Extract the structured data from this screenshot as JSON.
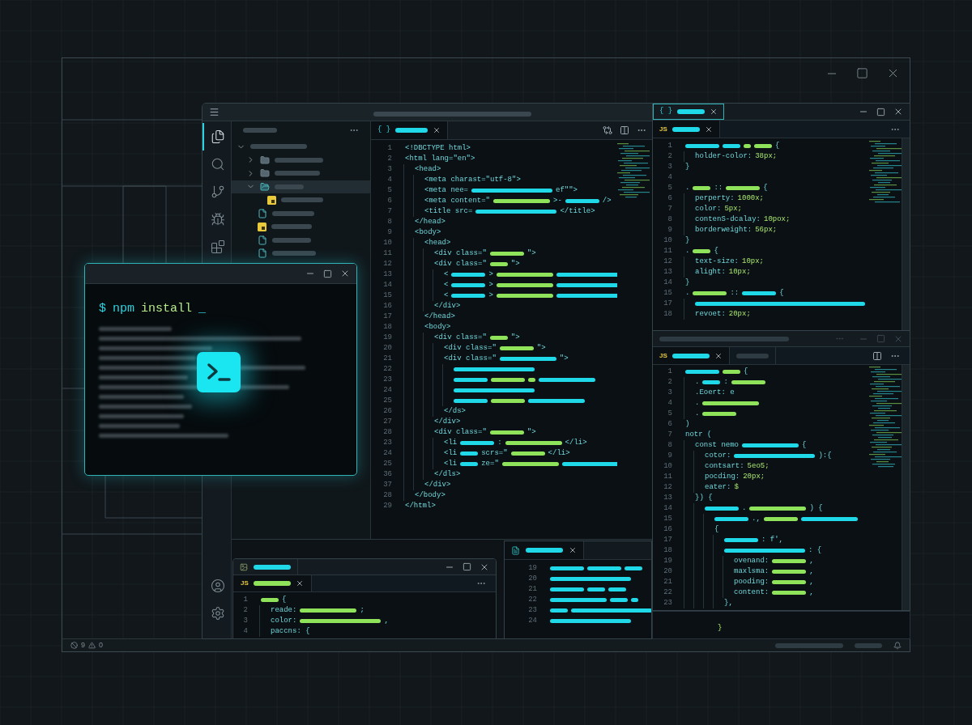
{
  "desktop_window": {
    "status_bar": {
      "errors": "9",
      "warnings": "0"
    }
  },
  "ide": {
    "activity_bar": [
      {
        "kind": "files",
        "selected": true
      },
      {
        "kind": "search",
        "selected": false
      },
      {
        "kind": "source-control",
        "selected": false
      },
      {
        "kind": "debug",
        "selected": false
      },
      {
        "kind": "extensions",
        "selected": false
      }
    ],
    "activity_bar_bottom": [
      {
        "kind": "account",
        "selected": false
      },
      {
        "kind": "settings",
        "selected": false
      }
    ],
    "explorer": {
      "items": [
        {
          "kind": "folder",
          "expanded": true,
          "selected": false,
          "children": [
            {
              "kind": "folder",
              "expanded": false,
              "selected": false
            },
            {
              "kind": "folder",
              "expanded": false,
              "selected": false
            },
            {
              "kind": "folder",
              "expanded": true,
              "selected": true,
              "children": [
                {
                  "kind": "js-file",
                  "selected": false
                }
              ]
            },
            {
              "kind": "file",
              "selected": false
            },
            {
              "kind": "js-file",
              "selected": false
            },
            {
              "kind": "file",
              "selected": false
            },
            {
              "kind": "file",
              "selected": false
            }
          ]
        }
      ]
    },
    "editor": {
      "tab": {
        "icon_text": "{ }"
      },
      "lines": [
        {
          "n": "1",
          "tokens": [
            {
              "kind": "text",
              "text": "<!DBCTYPE html>"
            }
          ]
        },
        {
          "n": "2",
          "tokens": [
            {
              "kind": "text",
              "text": "<html lang=\"en\">"
            }
          ],
          "children": [
            {
              "n": "3",
              "tokens": [
                {
                  "kind": "text",
                  "text": "<head>"
                }
              ],
              "children": [
                {
                  "n": "4",
                  "tokens": [
                    {
                      "kind": "text",
                      "text": "<meta charast=\"utf-8\">"
                    }
                  ]
                },
                {
                  "n": "5",
                  "tokens": [
                    {
                      "kind": "text",
                      "text": "<meta nee="
                    },
                    {
                      "kind": "wide-bar",
                      "color": "#1fd8e8"
                    },
                    {
                      "kind": "text",
                      "text": "ef\"\">"
                    }
                  ]
                },
                {
                  "n": "6",
                  "tokens": [
                    {
                      "kind": "text",
                      "text": "<meta content=\""
                    },
                    {
                      "kind": "long-bar",
                      "color": "#8fe35a"
                    },
                    {
                      "kind": "text",
                      "text": ">-"
                    },
                    {
                      "kind": "bar",
                      "color": "#1fd8e8"
                    },
                    {
                      "kind": "text",
                      "text": "/>"
                    }
                  ]
                },
                {
                  "n": "7",
                  "tokens": [
                    {
                      "kind": "text",
                      "text": "<title src="
                    },
                    {
                      "kind": "wide-bar",
                      "color": "#1fd8e8"
                    },
                    {
                      "kind": "text",
                      "text": "</title>"
                    }
                  ]
                }
              ]
            },
            {
              "n": "8",
              "tokens": [
                {
                  "kind": "text",
                  "text": "</head>"
                }
              ]
            },
            {
              "n": "9",
              "tokens": [
                {
                  "kind": "text",
                  "text": "<body>"
                }
              ],
              "children": [
                {
                  "n": "10",
                  "tokens": [
                    {
                      "kind": "text",
                      "text": "<head>"
                    }
                  ],
                  "children": [
                    {
                      "n": "11",
                      "tokens": [
                        {
                          "kind": "text",
                          "text": "<div class=\""
                        },
                        {
                          "kind": "bar",
                          "color": "#8fe35a"
                        },
                        {
                          "kind": "text",
                          "text": "\">"
                        }
                      ]
                    },
                    {
                      "n": "12",
                      "tokens": [
                        {
                          "kind": "text",
                          "text": "<div class=\""
                        },
                        {
                          "kind": "short-bar",
                          "color": "#8fe35a"
                        },
                        {
                          "kind": "text",
                          "text": "\">"
                        }
                      ],
                      "children": [
                        {
                          "n": "13",
                          "tokens": [
                            {
                              "kind": "text",
                              "text": "<"
                            },
                            {
                              "kind": "bar",
                              "color": "#1fd8e8"
                            },
                            {
                              "kind": "text",
                              "text": ">"
                            },
                            {
                              "kind": "long-bar",
                              "color": "#8fe35a"
                            },
                            {
                              "kind": "wide-bar",
                              "color": "#1fd8e8"
                            }
                          ]
                        },
                        {
                          "n": "14",
                          "tokens": [
                            {
                              "kind": "text",
                              "text": "<"
                            },
                            {
                              "kind": "bar",
                              "color": "#1fd8e8"
                            },
                            {
                              "kind": "text",
                              "text": ">"
                            },
                            {
                              "kind": "long-bar",
                              "color": "#8fe35a"
                            },
                            {
                              "kind": "wide-bar",
                              "color": "#1fd8e8"
                            }
                          ]
                        },
                        {
                          "n": "15",
                          "tokens": [
                            {
                              "kind": "text",
                              "text": "<"
                            },
                            {
                              "kind": "bar",
                              "color": "#1fd8e8"
                            },
                            {
                              "kind": "text",
                              "text": ">"
                            },
                            {
                              "kind": "long-bar",
                              "color": "#8fe35a"
                            },
                            {
                              "kind": "wide-bar",
                              "color": "#1fd8e8"
                            }
                          ]
                        }
                      ]
                    },
                    {
                      "n": "16",
                      "tokens": [
                        {
                          "kind": "text",
                          "text": "</div>"
                        }
                      ]
                    }
                  ]
                },
                {
                  "n": "17",
                  "tokens": [
                    {
                      "kind": "text",
                      "text": "</head>"
                    }
                  ]
                },
                {
                  "n": "18",
                  "tokens": [
                    {
                      "kind": "text",
                      "text": "<body>"
                    }
                  ],
                  "children": [
                    {
                      "n": "19",
                      "tokens": [
                        {
                          "kind": "text",
                          "text": "<div class=\""
                        },
                        {
                          "kind": "short-bar",
                          "color": "#8fe35a"
                        },
                        {
                          "kind": "text",
                          "text": "\">"
                        }
                      ],
                      "children": [
                        {
                          "n": "20",
                          "tokens": [
                            {
                              "kind": "text",
                              "text": "<div class=\""
                            },
                            {
                              "kind": "bar",
                              "color": "#8fe35a"
                            },
                            {
                              "kind": "text",
                              "text": "\">"
                            }
                          ]
                        },
                        {
                          "n": "21",
                          "tokens": [
                            {
                              "kind": "text",
                              "text": "<div class=\""
                            },
                            {
                              "kind": "long-bar",
                              "color": "#1fd8e8"
                            },
                            {
                              "kind": "text",
                              "text": "\">"
                            }
                          ],
                          "children": [
                            {
                              "n": "22",
                              "tokens": [
                                {
                                  "kind": "wide-bar",
                                  "color": "#1fd8e8"
                                }
                              ]
                            },
                            {
                              "n": "23",
                              "tokens": [
                                {
                                  "kind": "bar",
                                  "color": "#1fd8e8"
                                },
                                {
                                  "kind": "bar",
                                  "color": "#8fe35a"
                                },
                                {
                                  "kind": "tiny-bar",
                                  "color": "#8fe35a"
                                },
                                {
                                  "kind": "long-bar",
                                  "color": "#1fd8e8"
                                }
                              ]
                            },
                            {
                              "n": "24",
                              "tokens": [
                                {
                                  "kind": "wide-bar",
                                  "color": "#1fd8e8"
                                }
                              ]
                            },
                            {
                              "n": "25",
                              "tokens": [
                                {
                                  "kind": "bar",
                                  "color": "#1fd8e8"
                                },
                                {
                                  "kind": "bar",
                                  "color": "#8fe35a"
                                },
                                {
                                  "kind": "long-bar",
                                  "color": "#1fd8e8"
                                }
                              ]
                            }
                          ]
                        },
                        {
                          "n": "26",
                          "tokens": [
                            {
                              "kind": "text",
                              "text": "</ds>"
                            }
                          ]
                        }
                      ]
                    },
                    {
                      "n": "27",
                      "tokens": [
                        {
                          "kind": "text",
                          "text": "</div>"
                        }
                      ]
                    },
                    {
                      "n": "28",
                      "tokens": [
                        {
                          "kind": "text",
                          "text": "<div class=\""
                        },
                        {
                          "kind": "bar",
                          "color": "#8fe35a"
                        },
                        {
                          "kind": "text",
                          "text": "\">"
                        }
                      ],
                      "children": [
                        {
                          "n": "23",
                          "tokens": [
                            {
                              "kind": "text",
                              "text": "<li"
                            },
                            {
                              "kind": "bar",
                              "color": "#1fd8e8"
                            },
                            {
                              "kind": "text",
                              "text": ":"
                            },
                            {
                              "kind": "long-bar",
                              "color": "#8fe35a"
                            },
                            {
                              "kind": "text",
                              "text": "</li>"
                            }
                          ]
                        },
                        {
                          "n": "24",
                          "tokens": [
                            {
                              "kind": "text",
                              "text": "<li"
                            },
                            {
                              "kind": "short-bar",
                              "color": "#1fd8e8"
                            },
                            {
                              "kind": "text",
                              "text": "scrs=\""
                            },
                            {
                              "kind": "bar",
                              "color": "#8fe35a"
                            },
                            {
                              "kind": "text",
                              "text": "</li>"
                            }
                          ]
                        },
                        {
                          "n": "25",
                          "tokens": [
                            {
                              "kind": "text",
                              "text": "<li"
                            },
                            {
                              "kind": "short-bar",
                              "color": "#1fd8e8"
                            },
                            {
                              "kind": "text",
                              "text": "ze=\""
                            },
                            {
                              "kind": "long-bar",
                              "color": "#8fe35a"
                            },
                            {
                              "kind": "wide-bar",
                              "color": "#1fd8e8"
                            }
                          ]
                        }
                      ]
                    },
                    {
                      "n": "36",
                      "tokens": [
                        {
                          "kind": "text",
                          "text": "</dls>"
                        }
                      ]
                    }
                  ]
                },
                {
                  "n": "37",
                  "tokens": [
                    {
                      "kind": "text",
                      "text": "</div>"
                    }
                  ]
                }
              ]
            },
            {
              "n": "28",
              "tokens": [
                {
                  "kind": "text",
                  "text": "</body>"
                }
              ]
            }
          ]
        },
        {
          "n": "29",
          "tokens": [
            {
              "kind": "text",
              "text": "</html>"
            }
          ]
        }
      ]
    }
  },
  "terminal": {
    "prompt": "$",
    "command": "npm",
    "argument": "install",
    "cursor": "_"
  },
  "css_window": {
    "window_tab": {
      "icon_text": "{ }"
    },
    "file_tab": {
      "icon_text": "JS"
    },
    "lines": [
      {
        "n": "1",
        "tokens": [
          {
            "kind": "bar",
            "color": "#1fd8e8"
          },
          {
            "kind": "short-bar",
            "color": "#1fd8e8"
          },
          {
            "kind": "tiny-bar",
            "color": "#8fe35a"
          },
          {
            "kind": "short-bar",
            "color": "#8fe35a"
          },
          {
            "kind": "text",
            "text": "{"
          }
        ],
        "children": [
          {
            "n": "2",
            "tokens": [
              {
                "kind": "text",
                "text": "holder-color:"
              },
              {
                "kind": "value",
                "text": "38px;"
              }
            ]
          }
        ]
      },
      {
        "n": "3",
        "tokens": [
          {
            "kind": "text",
            "text": "}"
          }
        ]
      },
      {
        "n": "4"
      },
      {
        "n": "5",
        "tokens": [
          {
            "kind": "text",
            "text": "."
          },
          {
            "kind": "short-bar",
            "color": "#8fe35a"
          },
          {
            "kind": "text",
            "text": "::"
          },
          {
            "kind": "bar",
            "color": "#8fe35a"
          },
          {
            "kind": "text",
            "text": "{"
          }
        ],
        "children": [
          {
            "n": "6",
            "tokens": [
              {
                "kind": "text",
                "text": "perperty:"
              },
              {
                "kind": "value",
                "text": "1000x;"
              }
            ]
          },
          {
            "n": "7",
            "tokens": [
              {
                "kind": "text",
                "text": "color:"
              },
              {
                "kind": "value",
                "text": "5px;"
              }
            ]
          },
          {
            "n": "8",
            "tokens": [
              {
                "kind": "text",
                "text": "contenS-dcalay:"
              },
              {
                "kind": "value",
                "text": "10pox;"
              }
            ]
          },
          {
            "n": "9",
            "tokens": [
              {
                "kind": "text",
                "text": "borderweight:"
              },
              {
                "kind": "value",
                "text": "56px;"
              }
            ]
          }
        ]
      },
      {
        "n": "10",
        "tokens": [
          {
            "kind": "text",
            "text": "}"
          }
        ]
      },
      {
        "n": "11",
        "tokens": [
          {
            "kind": "text",
            "text": "."
          },
          {
            "kind": "short-bar",
            "color": "#8fe35a"
          },
          {
            "kind": "text",
            "text": "{"
          }
        ],
        "children": [
          {
            "n": "12",
            "tokens": [
              {
                "kind": "text",
                "text": "text-size:"
              },
              {
                "kind": "value",
                "text": "10px;"
              }
            ]
          },
          {
            "n": "13",
            "tokens": [
              {
                "kind": "text",
                "text": "alight:"
              },
              {
                "kind": "value",
                "text": "10px;"
              }
            ]
          }
        ]
      },
      {
        "n": "14",
        "tokens": [
          {
            "kind": "text",
            "text": "}"
          }
        ]
      },
      {
        "n": "15",
        "tokens": [
          {
            "kind": "text",
            "text": "."
          },
          {
            "kind": "bar",
            "color": "#8fe35a"
          },
          {
            "kind": "text",
            "text": "::"
          },
          {
            "kind": "bar",
            "color": "#1fd8e8"
          },
          {
            "kind": "text",
            "text": "{"
          }
        ],
        "children": [
          {
            "n": "17",
            "tokens": [
              {
                "kind": "full-bar",
                "color": "#1fd8e8"
              }
            ]
          },
          {
            "n": "18",
            "tokens": [
              {
                "kind": "text",
                "text": "revoet:"
              },
              {
                "kind": "value",
                "text": "20px;"
              }
            ]
          }
        ]
      }
    ]
  },
  "js_window": {
    "tabs": [
      {
        "icon_text": "JS",
        "selected": true
      },
      {
        "selected": false
      }
    ],
    "lines": [
      {
        "n": "1",
        "tokens": [
          {
            "kind": "bar",
            "color": "#1fd8e8"
          },
          {
            "kind": "short-bar",
            "color": "#8fe35a"
          },
          {
            "kind": "text",
            "text": "{"
          }
        ],
        "children": [
          {
            "n": "2",
            "tokens": [
              {
                "kind": "text",
                "text": "."
              },
              {
                "kind": "short-bar",
                "color": "#1fd8e8"
              },
              {
                "kind": "text",
                "text": ":"
              },
              {
                "kind": "bar",
                "color": "#8fe35a"
              }
            ]
          },
          {
            "n": "3",
            "tokens": [
              {
                "kind": "text",
                "text": ".Eoert: e"
              }
            ]
          },
          {
            "n": "4",
            "tokens": [
              {
                "kind": "text",
                "text": "."
              },
              {
                "kind": "long-bar",
                "color": "#8fe35a"
              }
            ]
          },
          {
            "n": "5",
            "tokens": [
              {
                "kind": "text",
                "text": "."
              },
              {
                "kind": "bar",
                "color": "#8fe35a"
              }
            ]
          }
        ]
      },
      {
        "n": "6",
        "tokens": [
          {
            "kind": "text",
            "text": ")"
          }
        ]
      },
      {
        "n": "7",
        "tokens": [
          {
            "kind": "text",
            "text": "notr ("
          }
        ],
        "children": [
          {
            "n": "8",
            "tokens": [
              {
                "kind": "text",
                "text": "const nemo"
              },
              {
                "kind": "long-bar",
                "color": "#1fd8e8"
              },
              {
                "kind": "text",
                "text": "{"
              }
            ],
            "children": [
              {
                "n": "9",
                "tokens": [
                  {
                    "kind": "text",
                    "text": "cotor:"
                  },
                  {
                    "kind": "wide-bar",
                    "color": "#1fd8e8"
                  },
                  {
                    "kind": "text",
                    "text": "):{"
                  }
                ]
              },
              {
                "n": "10",
                "tokens": [
                  {
                    "kind": "text",
                    "text": "contsart:"
                  },
                  {
                    "kind": "value",
                    "text": "5eo5;"
                  }
                ]
              },
              {
                "n": "11",
                "tokens": [
                  {
                    "kind": "text",
                    "text": "pocding:"
                  },
                  {
                    "kind": "value",
                    "text": "20px;"
                  }
                ]
              },
              {
                "n": "12",
                "tokens": [
                  {
                    "kind": "text",
                    "text": "eater:"
                  },
                  {
                    "kind": "value",
                    "text": "$"
                  }
                ]
              }
            ]
          },
          {
            "n": "13",
            "tokens": [
              {
                "kind": "text",
                "text": "}) {"
              }
            ],
            "children": [
              {
                "n": "14",
                "tokens": [
                  {
                    "kind": "bar",
                    "color": "#1fd8e8"
                  },
                  {
                    "kind": "text",
                    "text": "."
                  },
                  {
                    "kind": "long-bar",
                    "color": "#8fe35a"
                  },
                  {
                    "kind": "text",
                    "text": ") {"
                  }
                ],
                "children": [
                  {
                    "n": "15",
                    "tokens": [
                      {
                        "kind": "bar",
                        "color": "#1fd8e8"
                      },
                      {
                        "kind": "text",
                        "text": ".,"
                      },
                      {
                        "kind": "bar",
                        "color": "#8fe35a"
                      },
                      {
                        "kind": "long-bar",
                        "color": "#1fd8e8"
                      }
                    ]
                  },
                  {
                    "n": "16",
                    "tokens": [
                      {
                        "kind": "text",
                        "text": "{"
                      }
                    ],
                    "children": [
                      {
                        "n": "17",
                        "tokens": [
                          {
                            "kind": "bar",
                            "color": "#1fd8e8"
                          },
                          {
                            "kind": "text",
                            "text": ": f',"
                          }
                        ]
                      },
                      {
                        "n": "18",
                        "tokens": [
                          {
                            "kind": "wide-bar",
                            "color": "#1fd8e8"
                          },
                          {
                            "kind": "text",
                            "text": ": {"
                          }
                        ],
                        "children": [
                          {
                            "n": "19",
                            "tokens": [
                              {
                                "kind": "text",
                                "text": "ovenand:"
                              },
                              {
                                "kind": "bar",
                                "color": "#8fe35a"
                              },
                              {
                                "kind": "text",
                                "text": ","
                              }
                            ]
                          },
                          {
                            "n": "20",
                            "tokens": [
                              {
                                "kind": "text",
                                "text": "maxlsma:"
                              },
                              {
                                "kind": "bar",
                                "color": "#8fe35a"
                              },
                              {
                                "kind": "text",
                                "text": ","
                              }
                            ]
                          },
                          {
                            "n": "21",
                            "tokens": [
                              {
                                "kind": "text",
                                "text": "pooding:"
                              },
                              {
                                "kind": "bar",
                                "color": "#8fe35a"
                              },
                              {
                                "kind": "text",
                                "text": ","
                              }
                            ]
                          },
                          {
                            "n": "22",
                            "tokens": [
                              {
                                "kind": "text",
                                "text": "content:"
                              },
                              {
                                "kind": "bar",
                                "color": "#8fe35a"
                              },
                              {
                                "kind": "text",
                                "text": ","
                              }
                            ]
                          }
                        ]
                      },
                      {
                        "n": "23",
                        "tokens": [
                          {
                            "kind": "text",
                            "text": "},"
                          }
                        ]
                      }
                    ]
                  }
                ]
              }
            ]
          }
        ]
      }
    ]
  },
  "under_panel": {
    "text": "}"
  },
  "small_window": {
    "file_tab": {
      "icon_text": "JS"
    },
    "lines": [
      {
        "n": "1",
        "tokens": [
          {
            "kind": "short-bar",
            "color": "#8fe35a"
          },
          {
            "kind": "text",
            "text": "{"
          }
        ],
        "children": [
          {
            "n": "2",
            "tokens": [
              {
                "kind": "text",
                "text": "reade:"
              },
              {
                "kind": "long-bar",
                "color": "#8fe35a"
              },
              {
                "kind": "text",
                "text": ";"
              }
            ]
          },
          {
            "n": "3",
            "tokens": [
              {
                "kind": "text",
                "text": "color:"
              },
              {
                "kind": "wide-bar",
                "color": "#8fe35a"
              },
              {
                "kind": "text",
                "text": ","
              }
            ]
          },
          {
            "n": "4",
            "tokens": [
              {
                "kind": "text",
                "text": "paccns: {"
              }
            ]
          }
        ]
      }
    ]
  },
  "bottom_panel": {
    "lines": [
      {
        "n": "19",
        "tokens": [
          {
            "kind": "bar",
            "color": "#1fd8e8"
          },
          {
            "kind": "bar",
            "color": "#1fd8e8"
          },
          {
            "kind": "short-bar",
            "color": "#1fd8e8"
          }
        ]
      },
      {
        "n": "20",
        "tokens": [
          {
            "kind": "wide-bar",
            "color": "#1fd8e8"
          }
        ]
      },
      {
        "n": "21",
        "tokens": [
          {
            "kind": "bar",
            "color": "#1fd8e8"
          },
          {
            "kind": "short-bar",
            "color": "#1fd8e8"
          },
          {
            "kind": "short-bar",
            "color": "#1fd8e8"
          }
        ]
      },
      {
        "n": "22",
        "tokens": [
          {
            "kind": "long-bar",
            "color": "#1fd8e8"
          },
          {
            "kind": "short-bar",
            "color": "#1fd8e8"
          },
          {
            "kind": "tiny-bar",
            "color": "#1fd8e8"
          }
        ]
      },
      {
        "n": "23",
        "tokens": [
          {
            "kind": "short-bar",
            "color": "#1fd8e8"
          },
          {
            "kind": "wide-bar",
            "color": "#1fd8e8"
          }
        ]
      },
      {
        "n": "24",
        "tokens": [
          {
            "kind": "wide-bar",
            "color": "#1fd8e8"
          }
        ]
      }
    ]
  }
}
